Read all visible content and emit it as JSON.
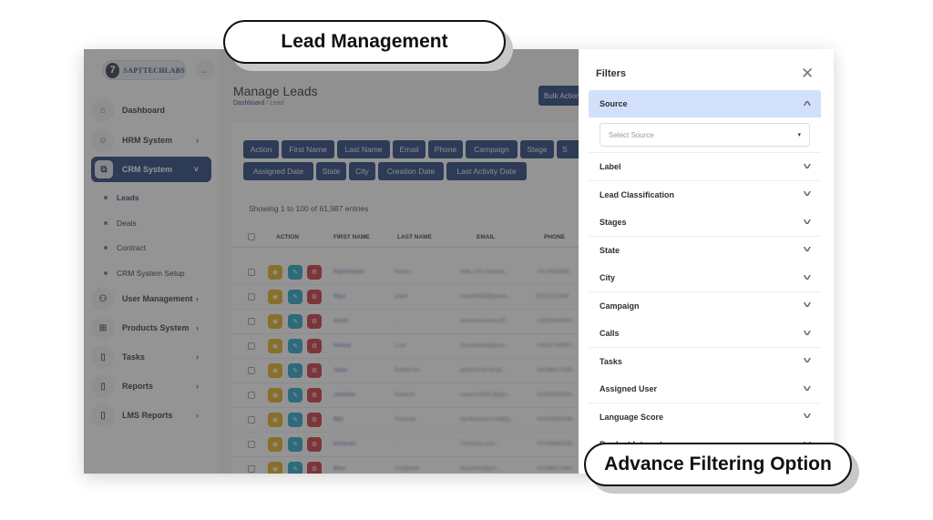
{
  "callouts": {
    "top": "Lead Management",
    "bottom": "Advance Filtering Option"
  },
  "sidebar": {
    "logo_text": "SAPTTECHLABS",
    "logo_mark": "7",
    "back_icon": "←",
    "items": [
      {
        "label": "Dashboard",
        "icon": "⌂",
        "chevron": ""
      },
      {
        "label": "HRM System",
        "icon": "☺",
        "chevron": "›"
      },
      {
        "label": "CRM System",
        "icon": "⧉",
        "chevron": "˅",
        "active": true
      },
      {
        "label": "User Management",
        "icon": "⚇",
        "chevron": "›"
      },
      {
        "label": "Products System",
        "icon": "⊞",
        "chevron": "›"
      },
      {
        "label": "Tasks",
        "icon": "▯",
        "chevron": "›"
      },
      {
        "label": "Reports",
        "icon": "▯",
        "chevron": "›"
      },
      {
        "label": "LMS Reports",
        "icon": "▯",
        "chevron": "›"
      }
    ],
    "sub_items": [
      {
        "label": "Leads",
        "active": true
      },
      {
        "label": "Deals"
      },
      {
        "label": "Contract"
      },
      {
        "label": "CRM System Setup"
      }
    ]
  },
  "main": {
    "title": "Manage Leads",
    "breadcrumb": {
      "home": "Dashboard",
      "sep": "/",
      "current": "Lead"
    },
    "bulk_action": "Bulk Action",
    "column_toggles_row1": [
      "Action",
      "First Name",
      "Last Name",
      "Email",
      "Phone",
      "Campaign",
      "Stage",
      "S"
    ],
    "column_toggles_row2": [
      "Assigned Date",
      "State",
      "City",
      "Creation Date",
      "Last Activity Date"
    ],
    "showing": "Showing 1 to 100 of 61,987 entries",
    "table_headers": [
      "ACTION",
      "FIRST NAME",
      "LAST NAME",
      "EMAIL",
      "PHONE"
    ],
    "rows": [
      {
        "first": "Ramcharan",
        "last": "Naidu...",
        "email": "balu.143.ramcha...",
        "phone": "+917682808..."
      },
      {
        "first": "Riya",
        "last": "patel",
        "email": "riyap9019@gmail...",
        "phone": "8310322089"
      },
      {
        "first": "Anish",
        "last": "-",
        "email": "anishchandran25...",
        "phone": "+9195448800..."
      },
      {
        "first": "Heena",
        "last": "Lodi",
        "email": "heenalodi@gmai...",
        "phone": "+9191782857..."
      },
      {
        "first": "Jidan",
        "last": "Rahaman",
        "email": "jidanrahaman@...",
        "phone": "+9198817548..."
      },
      {
        "first": "Jasmine",
        "last": "Ranesh",
        "email": "ranesmite91@gm...",
        "phone": "+9190918384..."
      },
      {
        "first": "Bijo",
        "last": "Thomas",
        "email": "bijothomasnmd@g...",
        "phone": "+9163889838..."
      },
      {
        "first": "krishnan",
        "last": "-",
        "email": "Thekrisu.com...",
        "phone": "+9199880248..."
      },
      {
        "first": "Binu",
        "last": "Varghese",
        "email": "binuvhai@gm...",
        "phone": "+9198812484..."
      }
    ],
    "action_icons": {
      "view": "◉",
      "edit": "✎",
      "delete": "⚙"
    }
  },
  "filters": {
    "title": "Filters",
    "close_icon": "✕",
    "open_section": {
      "label": "Source",
      "placeholder": "Select Source",
      "chevron": "˄",
      "caret": "▾"
    },
    "sections": [
      "Label",
      "Lead Classification",
      "Stages",
      "State",
      "City",
      "Campaign",
      "Calls",
      "Tasks",
      "Assigned User",
      "Language Score",
      "Product Interest"
    ],
    "collapsed_chevron": "˅"
  }
}
